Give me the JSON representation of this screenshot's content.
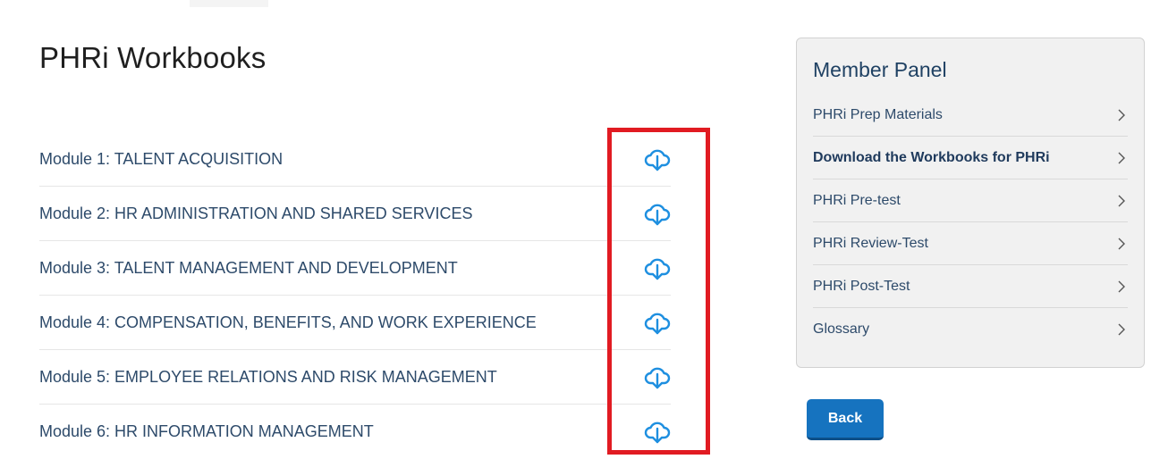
{
  "page": {
    "title": "PHRi Workbooks"
  },
  "modules": [
    {
      "label": "Module 1: TALENT ACQUISITION",
      "icon": "cloud-download-icon"
    },
    {
      "label": "Module 2: HR ADMINISTRATION AND SHARED SERVICES",
      "icon": "cloud-download-icon"
    },
    {
      "label": "Module 3: TALENT MANAGEMENT AND DEVELOPMENT",
      "icon": "cloud-download-icon"
    },
    {
      "label": "Module 4: COMPENSATION, BENEFITS, AND WORK EXPERIENCE",
      "icon": "cloud-download-icon"
    },
    {
      "label": "Module 5: EMPLOYEE RELATIONS AND RISK MANAGEMENT",
      "icon": "cloud-download-icon"
    },
    {
      "label": "Module 6: HR INFORMATION MANAGEMENT",
      "icon": "cloud-download-icon"
    }
  ],
  "member_panel": {
    "title": "Member Panel",
    "items": [
      {
        "label": "PHRi Prep Materials",
        "active": false
      },
      {
        "label": "Download the Workbooks for PHRi",
        "active": true
      },
      {
        "label": "PHRi Pre-test",
        "active": false
      },
      {
        "label": "PHRi Review-Test",
        "active": false
      },
      {
        "label": "PHRi Post-Test",
        "active": false
      },
      {
        "label": "Glossary",
        "active": false
      }
    ]
  },
  "actions": {
    "back_label": "Back"
  },
  "colors": {
    "link_text": "#2d4a6a",
    "icon_blue": "#1e8fe0",
    "button_blue": "#1673bf",
    "highlight_red": "#e11b22",
    "panel_bg": "#f1f1f1"
  }
}
